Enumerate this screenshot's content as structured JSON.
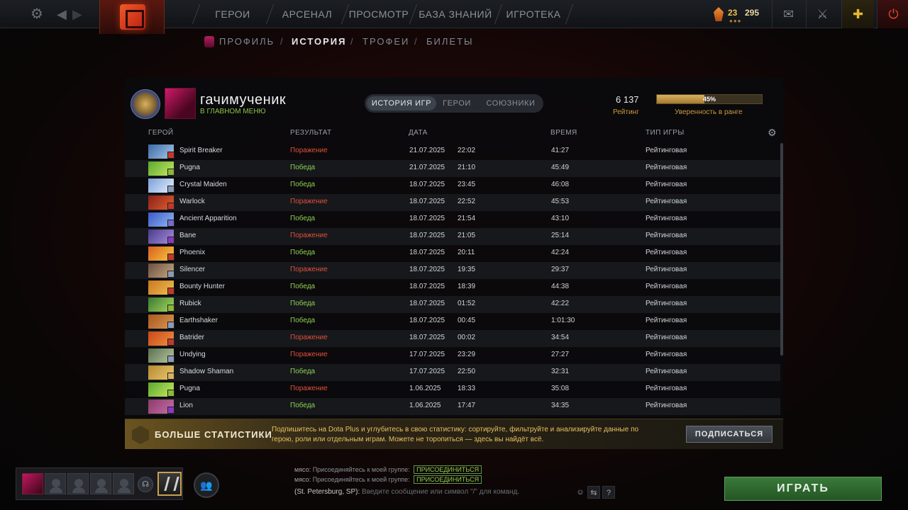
{
  "topnav": {
    "items": [
      "ГЕРОИ",
      "АРСЕНАЛ",
      "ПРОСМОТР",
      "БАЗА ЗНАНИЙ",
      "ИГРОТЕКА"
    ],
    "resource_a": "23",
    "resource_b": "295"
  },
  "subnav": {
    "profile": "ПРОФИЛЬ",
    "history": "ИСТОРИЯ",
    "trophies": "ТРОФЕИ",
    "tickets": "БИЛЕТЫ",
    "sep": "/"
  },
  "player": {
    "name": "гачимученик",
    "status": "В ГЛАВНОМ МЕНЮ"
  },
  "tabs": [
    "ИСТОРИЯ ИГР",
    "ГЕРОИ",
    "СОЮЗНИКИ"
  ],
  "rating": {
    "value": "6 137",
    "label": "Рейтинг",
    "confidence_text": "45%",
    "confidence": 0.45,
    "confidence_label": "Уверенность в ранге"
  },
  "table": {
    "headers": [
      "ГЕРОЙ",
      "РЕЗУЛЬТАТ",
      "ДАТА",
      "ВРЕМЯ",
      "ТИП ИГРЫ"
    ],
    "rows": [
      {
        "hero": "Spirit Breaker",
        "result": "Поражение",
        "win": false,
        "date": "21.07.2025",
        "time": "22:02",
        "duration": "41:27",
        "type": "Рейтинговая",
        "c1": "#3a6aa8",
        "c2": "#a8c8e8",
        "role": "#c0392b"
      },
      {
        "hero": "Pugna",
        "result": "Победа",
        "win": true,
        "date": "21.07.2025",
        "time": "21:10",
        "duration": "45:49",
        "type": "Рейтинговая",
        "c1": "#5aa830",
        "c2": "#c8e860",
        "role": "#8ab838"
      },
      {
        "hero": "Crystal Maiden",
        "result": "Победа",
        "win": true,
        "date": "18.07.2025",
        "time": "23:45",
        "duration": "46:08",
        "type": "Рейтинговая",
        "c1": "#7aa0d8",
        "c2": "#e8f0ff",
        "role": "#8a9ab8"
      },
      {
        "hero": "Warlock",
        "result": "Поражение",
        "win": false,
        "date": "18.07.2025",
        "time": "22:52",
        "duration": "45:53",
        "type": "Рейтинговая",
        "c1": "#8a2018",
        "c2": "#e06030",
        "role": "#c0392b"
      },
      {
        "hero": "Ancient Apparition",
        "result": "Победа",
        "win": true,
        "date": "18.07.2025",
        "time": "21:54",
        "duration": "43:10",
        "type": "Рейтинговая",
        "c1": "#3a5ac8",
        "c2": "#90b8f0",
        "role": "#7a6ad0"
      },
      {
        "hero": "Bane",
        "result": "Поражение",
        "win": false,
        "date": "18.07.2025",
        "time": "21:05",
        "duration": "25:14",
        "type": "Рейтинговая",
        "c1": "#4a3a8a",
        "c2": "#a890e0",
        "role": "#8a3ac0"
      },
      {
        "hero": "Phoenix",
        "result": "Победа",
        "win": true,
        "date": "18.07.2025",
        "time": "20:11",
        "duration": "42:24",
        "type": "Рейтинговая",
        "c1": "#d86020",
        "c2": "#f8c840",
        "role": "#c0392b"
      },
      {
        "hero": "Silencer",
        "result": "Поражение",
        "win": false,
        "date": "18.07.2025",
        "time": "19:35",
        "duration": "29:37",
        "type": "Рейтинговая",
        "c1": "#6a5040",
        "c2": "#c8a880",
        "role": "#8a9ab8"
      },
      {
        "hero": "Bounty Hunter",
        "result": "Победа",
        "win": true,
        "date": "18.07.2025",
        "time": "18:39",
        "duration": "44:38",
        "type": "Рейтинговая",
        "c1": "#c87820",
        "c2": "#f0c050",
        "role": "#c0392b"
      },
      {
        "hero": "Rubick",
        "result": "Победа",
        "win": true,
        "date": "18.07.2025",
        "time": "01:52",
        "duration": "42:22",
        "type": "Рейтинговая",
        "c1": "#3a7a30",
        "c2": "#a8d860",
        "role": "#8ab838"
      },
      {
        "hero": "Earthshaker",
        "result": "Победа",
        "win": true,
        "date": "18.07.2025",
        "time": "00:45",
        "duration": "1:01:30",
        "type": "Рейтинговая",
        "c1": "#a85820",
        "c2": "#d89850",
        "role": "#8a9ab8"
      },
      {
        "hero": "Batrider",
        "result": "Поражение",
        "win": false,
        "date": "18.07.2025",
        "time": "00:02",
        "duration": "34:54",
        "type": "Рейтинговая",
        "c1": "#c84818",
        "c2": "#f09040",
        "role": "#c0392b"
      },
      {
        "hero": "Undying",
        "result": "Поражение",
        "win": false,
        "date": "17.07.2025",
        "time": "23:29",
        "duration": "27:27",
        "type": "Рейтинговая",
        "c1": "#5a7050",
        "c2": "#b8c8a0",
        "role": "#8a9ab8"
      },
      {
        "hero": "Shadow Shaman",
        "result": "Победа",
        "win": true,
        "date": "17.07.2025",
        "time": "22:50",
        "duration": "32:31",
        "type": "Рейтинговая",
        "c1": "#b88a30",
        "c2": "#e8c870",
        "role": "#d8b060"
      },
      {
        "hero": "Pugna",
        "result": "Поражение",
        "win": false,
        "date": "1.06.2025",
        "time": "18:33",
        "duration": "35:08",
        "type": "Рейтинговая",
        "c1": "#5aa830",
        "c2": "#c8e860",
        "role": "#8ab838"
      },
      {
        "hero": "Lion",
        "result": "Победа",
        "win": true,
        "date": "1.06.2025",
        "time": "17:47",
        "duration": "34:35",
        "type": "Рейтинговая",
        "c1": "#8a3a6a",
        "c2": "#c870a8",
        "role": "#8a3ac0"
      }
    ]
  },
  "promo": {
    "title": "БОЛЬШЕ СТАТИСТИКИ",
    "text": "Подпишитесь на Dota Plus и углубитесь в свою статистику: сортируйте, фильтруйте и анализируйте данные по герою, роли или отдельным играм. Можете не торопиться — здесь вы найдёт всё.",
    "button": "ПОДПИСАТЬСЯ"
  },
  "chat": {
    "lines": [
      {
        "who": "мясо:",
        "text": "Присоединяйтесь к моей группе:",
        "join": "ПРИСОЕДИНИТЬСЯ"
      },
      {
        "who": "мясо:",
        "text": "Присоединяйтесь к моей группе:",
        "join": "ПРИСОЕДИНИТЬСЯ"
      }
    ],
    "channel": "(St. Petersburg, SP):",
    "placeholder": "Введите сообщение или символ \"/\" для команд."
  },
  "play_button": "ИГРАТЬ",
  "icons": {
    "settings": "gear-icon",
    "back": "arrow-left-icon",
    "forward": "arrow-right-icon",
    "mail": "mail-icon",
    "armory": "sword-icon",
    "dota_plus": "plus-icon",
    "power": "power-icon"
  }
}
